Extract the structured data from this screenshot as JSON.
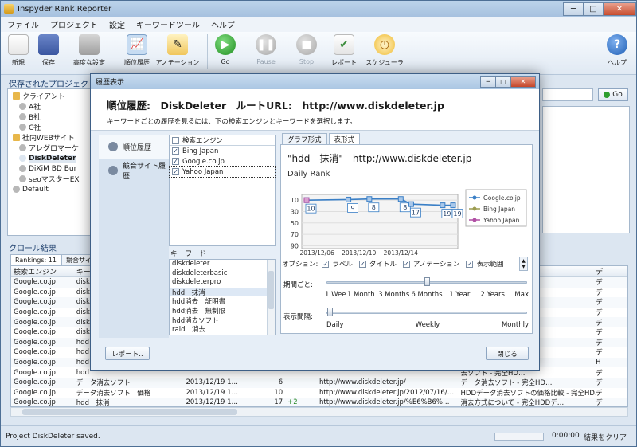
{
  "app": {
    "title": "Inspyder Rank Reporter",
    "window_controls": {
      "minimize": "─",
      "maximize": "□",
      "close": "✕"
    }
  },
  "menu": [
    "ファイル",
    "プロジェクト",
    "設定",
    "キーワードツール",
    "ヘルプ"
  ],
  "toolbar": [
    {
      "label": "新規",
      "icon": "new-document-icon",
      "glyph": "",
      "state": "normal"
    },
    {
      "label": "保存",
      "icon": "save-icon",
      "glyph": "",
      "state": "normal"
    },
    {
      "label": "高度な設定",
      "icon": "wrench-icon",
      "glyph": "",
      "state": "normal"
    },
    {
      "label": "順位履歴",
      "icon": "rank-history-chart-icon",
      "glyph": "📈",
      "state": "active"
    },
    {
      "label": "アノテーション",
      "icon": "annotation-pen-icon",
      "glyph": "✎",
      "state": "normal"
    },
    {
      "label": "Go",
      "icon": "go-play-icon",
      "glyph": "▶",
      "state": "normal"
    },
    {
      "label": "Pause",
      "icon": "pause-icon",
      "glyph": "❚❚",
      "state": "disabled"
    },
    {
      "label": "Stop",
      "icon": "stop-icon",
      "glyph": "■",
      "state": "disabled"
    },
    {
      "label": "レポート",
      "icon": "report-icon",
      "glyph": "✔",
      "state": "normal"
    },
    {
      "label": "スケジューラ",
      "icon": "scheduler-clock-icon",
      "glyph": "◷",
      "state": "normal"
    },
    {
      "label": "ヘルプ",
      "icon": "help-icon",
      "glyph": "?",
      "state": "normal"
    }
  ],
  "sidebar": {
    "title": "保存されたプロジェクト",
    "tree": [
      {
        "label": "クライアント",
        "level": 0,
        "folder": true
      },
      {
        "label": "A社",
        "level": 1
      },
      {
        "label": "B社",
        "level": 1
      },
      {
        "label": "C社",
        "level": 1
      },
      {
        "label": "社内WEBサイト",
        "level": 0,
        "folder": true
      },
      {
        "label": "アレグロマーケ",
        "level": 1
      },
      {
        "label": "DiskDeleter",
        "level": 1,
        "selected": true
      },
      {
        "label": "DiXiM BD Bur",
        "level": 1
      },
      {
        "label": "seoマスターEX",
        "level": 1
      },
      {
        "label": "Default",
        "level": 0
      }
    ]
  },
  "go_button": "Go",
  "results": {
    "title": "クロール結果",
    "tabs": [
      "Rankings: 11",
      "競合サイ"
    ],
    "headers": [
      "検索エンジン",
      "キー",
      "",
      "",
      "",
      "",
      "",
      "デ"
    ],
    "rows": [
      [
        "Google.co.jp",
        "disk",
        "",
        "",
        "",
        "",
        "ータ消去集…",
        "デ"
      ],
      [
        "Google.co.jp",
        "disk",
        "",
        "",
        "",
        "",
        "HDDデータ消去…",
        "デ"
      ],
      [
        "Google.co.jp",
        "disk",
        "",
        "",
        "",
        "",
        "去ソフト - 完全HD…",
        "デ"
      ],
      [
        "Google.co.jp",
        "disk",
        "",
        "",
        "",
        "",
        "ータ消去集…",
        "デ"
      ],
      [
        "Google.co.jp",
        "disk",
        "",
        "",
        "",
        "",
        "HDDデータ消去…",
        "デ"
      ],
      [
        "Google.co.jp",
        "disk",
        "",
        "",
        "",
        "",
        "去ソフト - 完全HD…",
        "デ"
      ],
      [
        "Google.co.jp",
        "hdd",
        "",
        "",
        "",
        "",
        "ついて - 完全HDD…",
        "デ"
      ],
      [
        "Google.co.jp",
        "hdd",
        "",
        "",
        "",
        "",
        "- 完全HDDデ…",
        "デ"
      ],
      [
        "Google.co.jp",
        "hdd",
        "",
        "",
        "",
        "",
        "HDDデータ消去…",
        "H"
      ],
      [
        "Google.co.jp",
        "hdd",
        "",
        "",
        "",
        "",
        "去ソフト - 完全HD…",
        "デ"
      ],
      [
        "Google.co.jp",
        "データ消去ソフト",
        "2013/12/19 1…",
        "6",
        "",
        "http://www.diskdeleter.jp/",
        "データ消去ソフト - 完全HD…",
        "デ"
      ],
      [
        "Google.co.jp",
        "データ消去ソフト　価格",
        "2013/12/19 1…",
        "10",
        "",
        "http://www.diskdeleter.jp/2012/07/16/…",
        "HDDデータ消去ソフトの価格比較 - 完全HD…",
        "デ"
      ],
      [
        "Google.co.jp",
        "hdd　抹消",
        "2013/12/19 1…",
        "17",
        "+2",
        "http://www.diskdeleter.jp/%E6%B6%…",
        "消去方式について - 完全HDDデ…",
        "デ"
      ],
      [
        "Google.co.jp",
        "hdd　抹消　…",
        "2013/12/19 1…",
        "",
        "",
        "http://www.diskdeleter.jp/…",
        "…",
        "デ"
      ]
    ]
  },
  "status": {
    "text": "Project DiskDeleter saved.",
    "time": "0:00:00",
    "clear": "結果をクリア"
  },
  "dialog": {
    "title": "履歴表示",
    "heading": "順位履歴:　DiskDeleter　ルートURL:　http://www.diskdeleter.jp",
    "subtitle": "キーワードごとの履歴を見るには、下の検索エンジンとキーワードを選択します。",
    "side_items": [
      "順位履歴",
      "競合サイト履歴"
    ],
    "engines_header": "検索エンジン",
    "engines": [
      {
        "label": "Bing Japan",
        "checked": true
      },
      {
        "label": "Google.co.jp",
        "checked": true
      },
      {
        "label": "Yahoo Japan",
        "checked": true
      }
    ],
    "keywords_label": "キーワード",
    "keywords": [
      "diskdeleter",
      "diskdeleterbasic",
      "diskdeleterpro",
      "hdd　抹消",
      "hdd消去　証明書",
      "hdd消去　無制限",
      "hdd消去ソフト",
      "raid　消去"
    ],
    "selected_keyword": "hdd　抹消",
    "chart_tabs": [
      "グラフ形式",
      "表形式"
    ],
    "options_label": "オプション:",
    "options": [
      {
        "label": "ラベル",
        "checked": true
      },
      {
        "label": "タイトル",
        "checked": true
      },
      {
        "label": "アノテーション",
        "checked": true
      },
      {
        "label": "表示範囲",
        "checked": true
      }
    ],
    "period_label": "期間ごと:",
    "period_ticks": [
      "1 Wee",
      "1 Month",
      "3 Months",
      "6 Months",
      "1 Year",
      "2 Years",
      "Max"
    ],
    "period_selected": "6 Months",
    "interval_label": "表示間隔:",
    "interval_ticks": [
      "Daily",
      "Weekly",
      "Monthly"
    ],
    "interval_selected": "Daily",
    "report_button": "レポート..",
    "close_button": "閉じる"
  },
  "chart_data": {
    "type": "line",
    "title": "\"hdd　抹消\" - http://www.diskdeleter.jp",
    "subtitle": "Daily Rank",
    "y_ticks": [
      10,
      30,
      50,
      70,
      90
    ],
    "ylim": [
      0,
      95
    ],
    "y_inverted": true,
    "x_ticks_upper": [
      "2013/12/06",
      "2013/12/10",
      "2013/12/14"
    ],
    "x_ticks_lower": [
      "2013/12/08",
      "2013/12/12",
      "2013/12/16"
    ],
    "x": [
      "2013/12/05",
      "2013/12/06",
      "2013/12/07",
      "2013/12/08",
      "2013/12/09",
      "2013/12/10",
      "2013/12/11",
      "2013/12/12",
      "2013/12/13",
      "2013/12/14",
      "2013/12/15",
      "2013/12/16",
      "2013/12/17",
      "2013/12/18",
      "2013/12/19"
    ],
    "series": [
      {
        "name": "Google.co.jp",
        "color": "#3a7fc6",
        "values": [
          10,
          null,
          null,
          null,
          9,
          null,
          8,
          null,
          null,
          8,
          17,
          null,
          null,
          19,
          19
        ],
        "data_labels": [
          10,
          null,
          null,
          null,
          9,
          null,
          8,
          null,
          null,
          8,
          17,
          null,
          null,
          19,
          19
        ]
      },
      {
        "name": "Bing Japan",
        "color": "#9c9c50",
        "values": []
      },
      {
        "name": "Yahoo Japan",
        "color": "#b04fa4",
        "values": []
      }
    ],
    "legend": "right"
  }
}
